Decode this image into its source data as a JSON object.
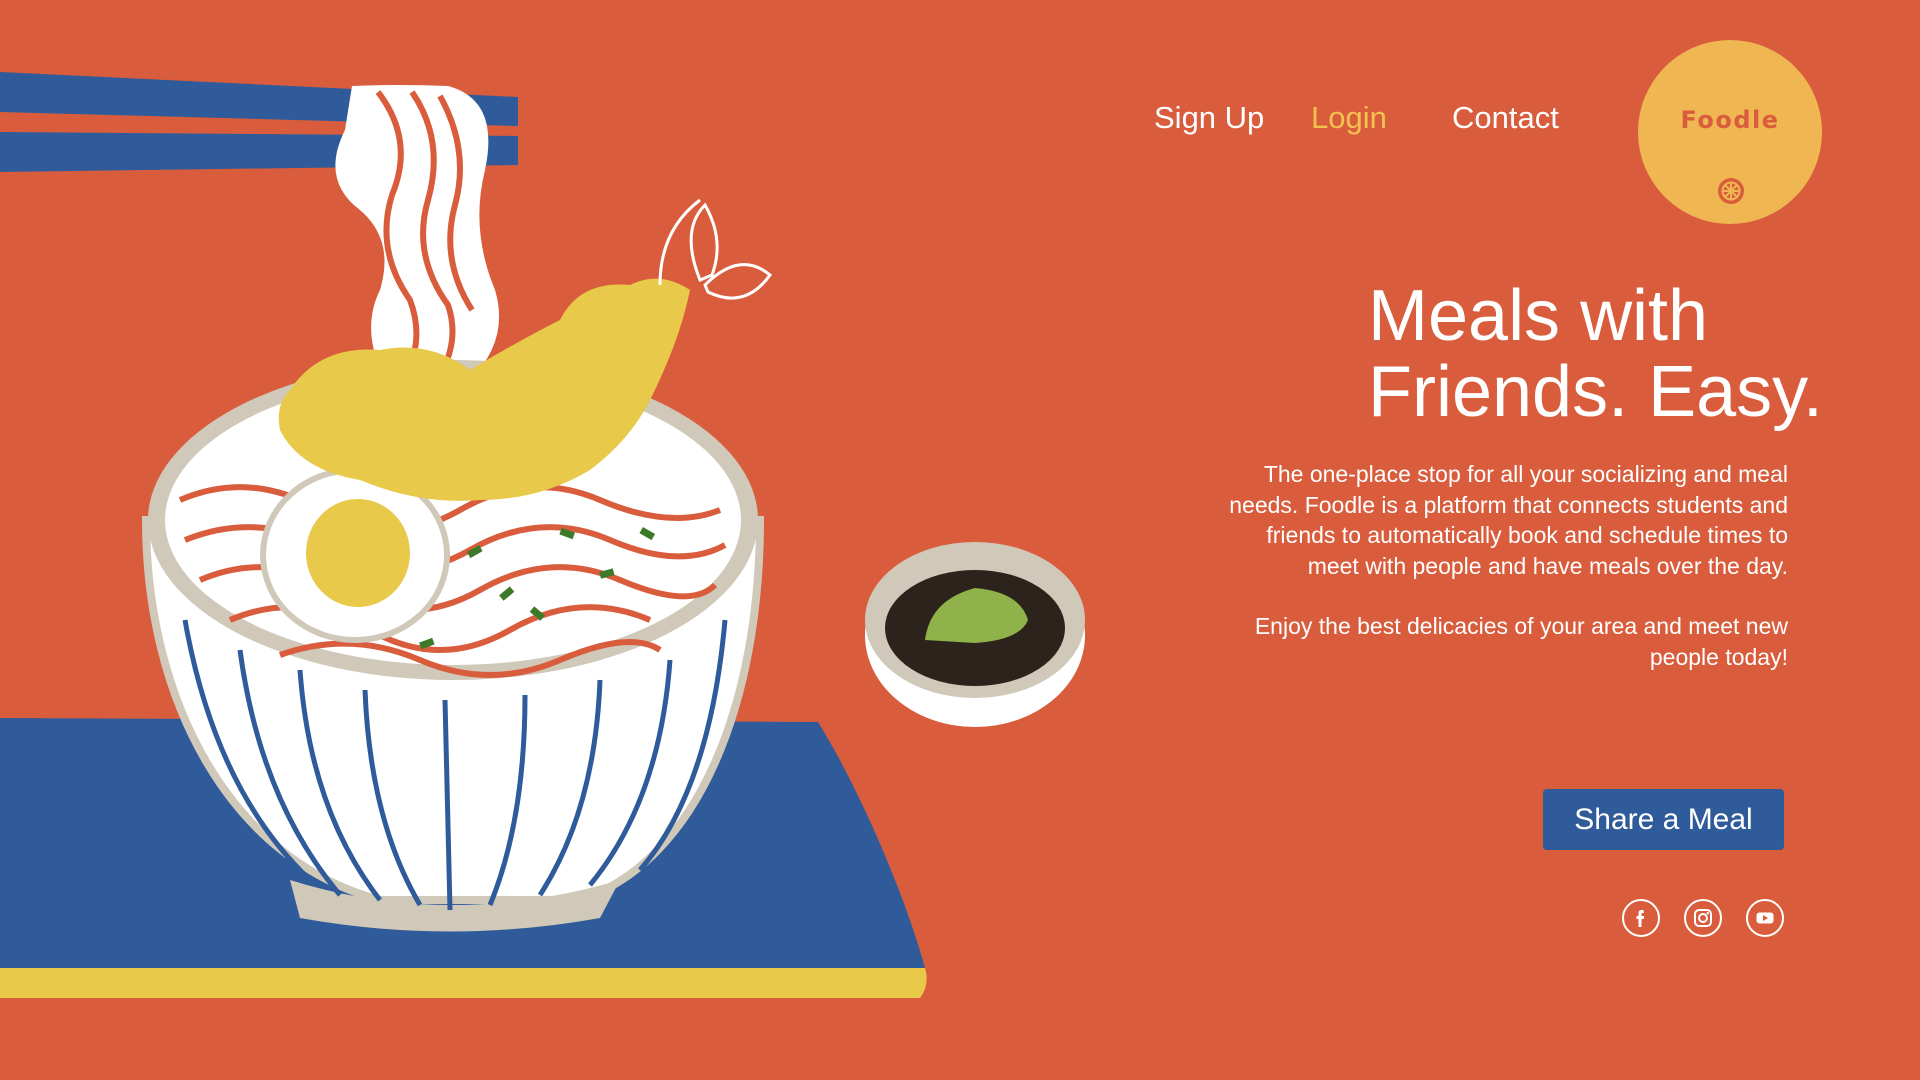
{
  "nav": {
    "items": [
      {
        "label": "Sign Up"
      },
      {
        "label": "Login"
      },
      {
        "label": "Contact"
      }
    ],
    "active_color": "#F2C14E",
    "default_color": "#FFFFFF"
  },
  "logo": {
    "text": "Foodle",
    "icon": "lemon-slice-icon",
    "background": "#EFB651"
  },
  "hero": {
    "headline_line1": "Meals with",
    "headline_line2": "Friends. Easy.",
    "paragraph1": "The one-place stop for all your socializing and meal needs. Foodle is a platform that connects students and friends to automatically book and schedule times to meet with people and have meals over the day.",
    "paragraph2": "Enjoy the best delicacies of your area and meet new people today!",
    "cta_label": "Share a Meal"
  },
  "social": [
    {
      "icon": "facebook-icon"
    },
    {
      "icon": "instagram-icon"
    },
    {
      "icon": "youtube-icon"
    }
  ],
  "colors": {
    "background": "#D95D3D",
    "accent_blue": "#2F5B9A",
    "accent_yellow": "#E8C94A",
    "text": "#FFFFFF"
  }
}
